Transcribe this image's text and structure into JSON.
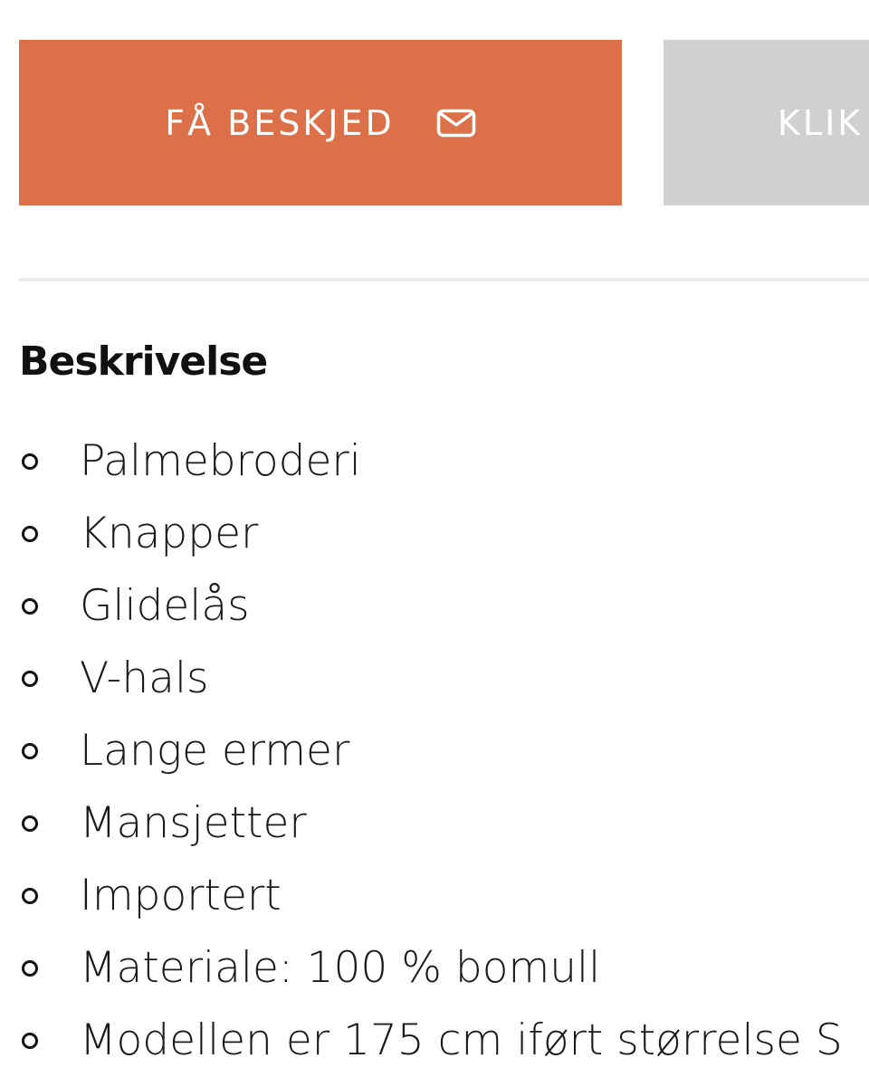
{
  "buttons": {
    "notify_label": "FÅ BESKJED",
    "notify_icon": "envelope-icon",
    "secondary_label": "KLIK",
    "primary_color": "#dc7049",
    "secondary_color": "#d0d0d0"
  },
  "description": {
    "heading": "Beskrivelse",
    "items": [
      "Palmebroderi",
      "Knapper",
      "Glidelås",
      "V-hals",
      "Lange ermer",
      "Mansjetter",
      "Importert",
      "Materiale: 100 % bomull",
      "Modellen er 175 cm iført størrelse S"
    ]
  }
}
